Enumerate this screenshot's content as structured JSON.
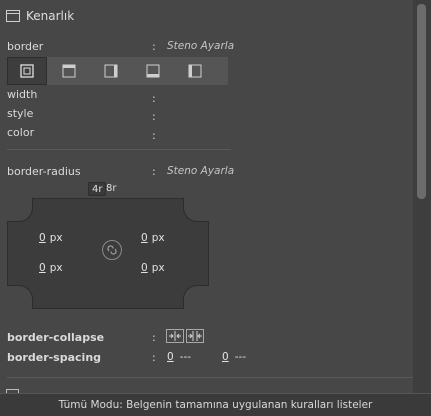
{
  "section": {
    "title": "Kenarlık",
    "icon": "panel-icon"
  },
  "border": {
    "label": "border",
    "colon": ":",
    "value": "Steno Ayarla"
  },
  "tabs": [
    {
      "name": "all-sides",
      "icon": "border-all-icon",
      "active": true
    },
    {
      "name": "top",
      "icon": "border-top-icon",
      "active": false
    },
    {
      "name": "right",
      "icon": "border-right-icon",
      "active": false
    },
    {
      "name": "bottom",
      "icon": "border-bottom-icon",
      "active": false
    },
    {
      "name": "left",
      "icon": "border-left-icon",
      "active": false
    }
  ],
  "props": [
    {
      "label": "width",
      "colon": ":"
    },
    {
      "label": "style",
      "colon": ":"
    },
    {
      "label": "color",
      "colon": ":"
    }
  ],
  "radius": {
    "label": "border-radius",
    "colon": ":",
    "value": "Steno Ayarla",
    "mode_4r": "4r",
    "mode_8r": "8r",
    "top_left": {
      "value": "0",
      "unit": "px"
    },
    "top_right": {
      "value": "0",
      "unit": "px"
    },
    "bottom_left": {
      "value": "0",
      "unit": "px"
    },
    "bottom_right": {
      "value": "0",
      "unit": "px"
    },
    "link_icon": "link-icon"
  },
  "collapse": {
    "label": "border-collapse",
    "colon": ":"
  },
  "spacing": {
    "label": "border-spacing",
    "colon": ":",
    "h_value": "0",
    "h_unit": "---",
    "v_value": "0",
    "v_unit": "---"
  },
  "status": {
    "text": "Tümü Modu: Belgenin tamamına uygulanan kuralları listeler"
  },
  "colors": {
    "background": "#474747",
    "field": "#3c3c3c",
    "text": "#d6d6d6"
  }
}
